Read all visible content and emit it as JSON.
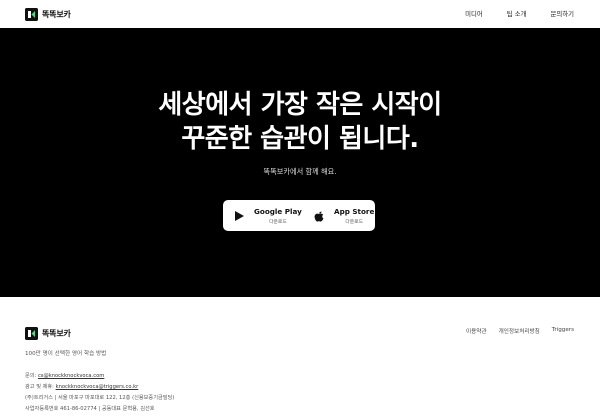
{
  "header": {
    "brand": "똑똑보카",
    "nav": [
      "미디어",
      "팁 소개",
      "문의하기"
    ]
  },
  "hero": {
    "title_line1": "세상에서 가장 작은 시작이",
    "title_line2": "꾸준한 습관이 됩니다.",
    "subtitle": "똑똑보카에서 함께 해요.",
    "google_play": {
      "label": "Google Play",
      "sub": "다운로드"
    },
    "app_store": {
      "label": "App Store",
      "sub": "다운로드"
    }
  },
  "footer": {
    "brand": "똑똑보카",
    "tagline": "100만 명이 선택한 영어 학습 방법",
    "links": [
      "이용약관",
      "개인정보처리방침",
      "Triggers"
    ],
    "contact_label": "문의:",
    "contact_email": "cs@knockknockvoca.com",
    "ads_label": "광고 및 제휴:",
    "ads_email": "knockknockvoca@triggers.co.kr",
    "address": "(주)트리거스  |  서울 마포구 마포대로 122, 12층 (신용보증기금빌딩)",
    "business": "사업자등록번호 461-86-02774  |  공동대표 문혁용, 김선호"
  },
  "colors": {
    "hero_bg": "#000000",
    "accent": "#22c55e"
  }
}
